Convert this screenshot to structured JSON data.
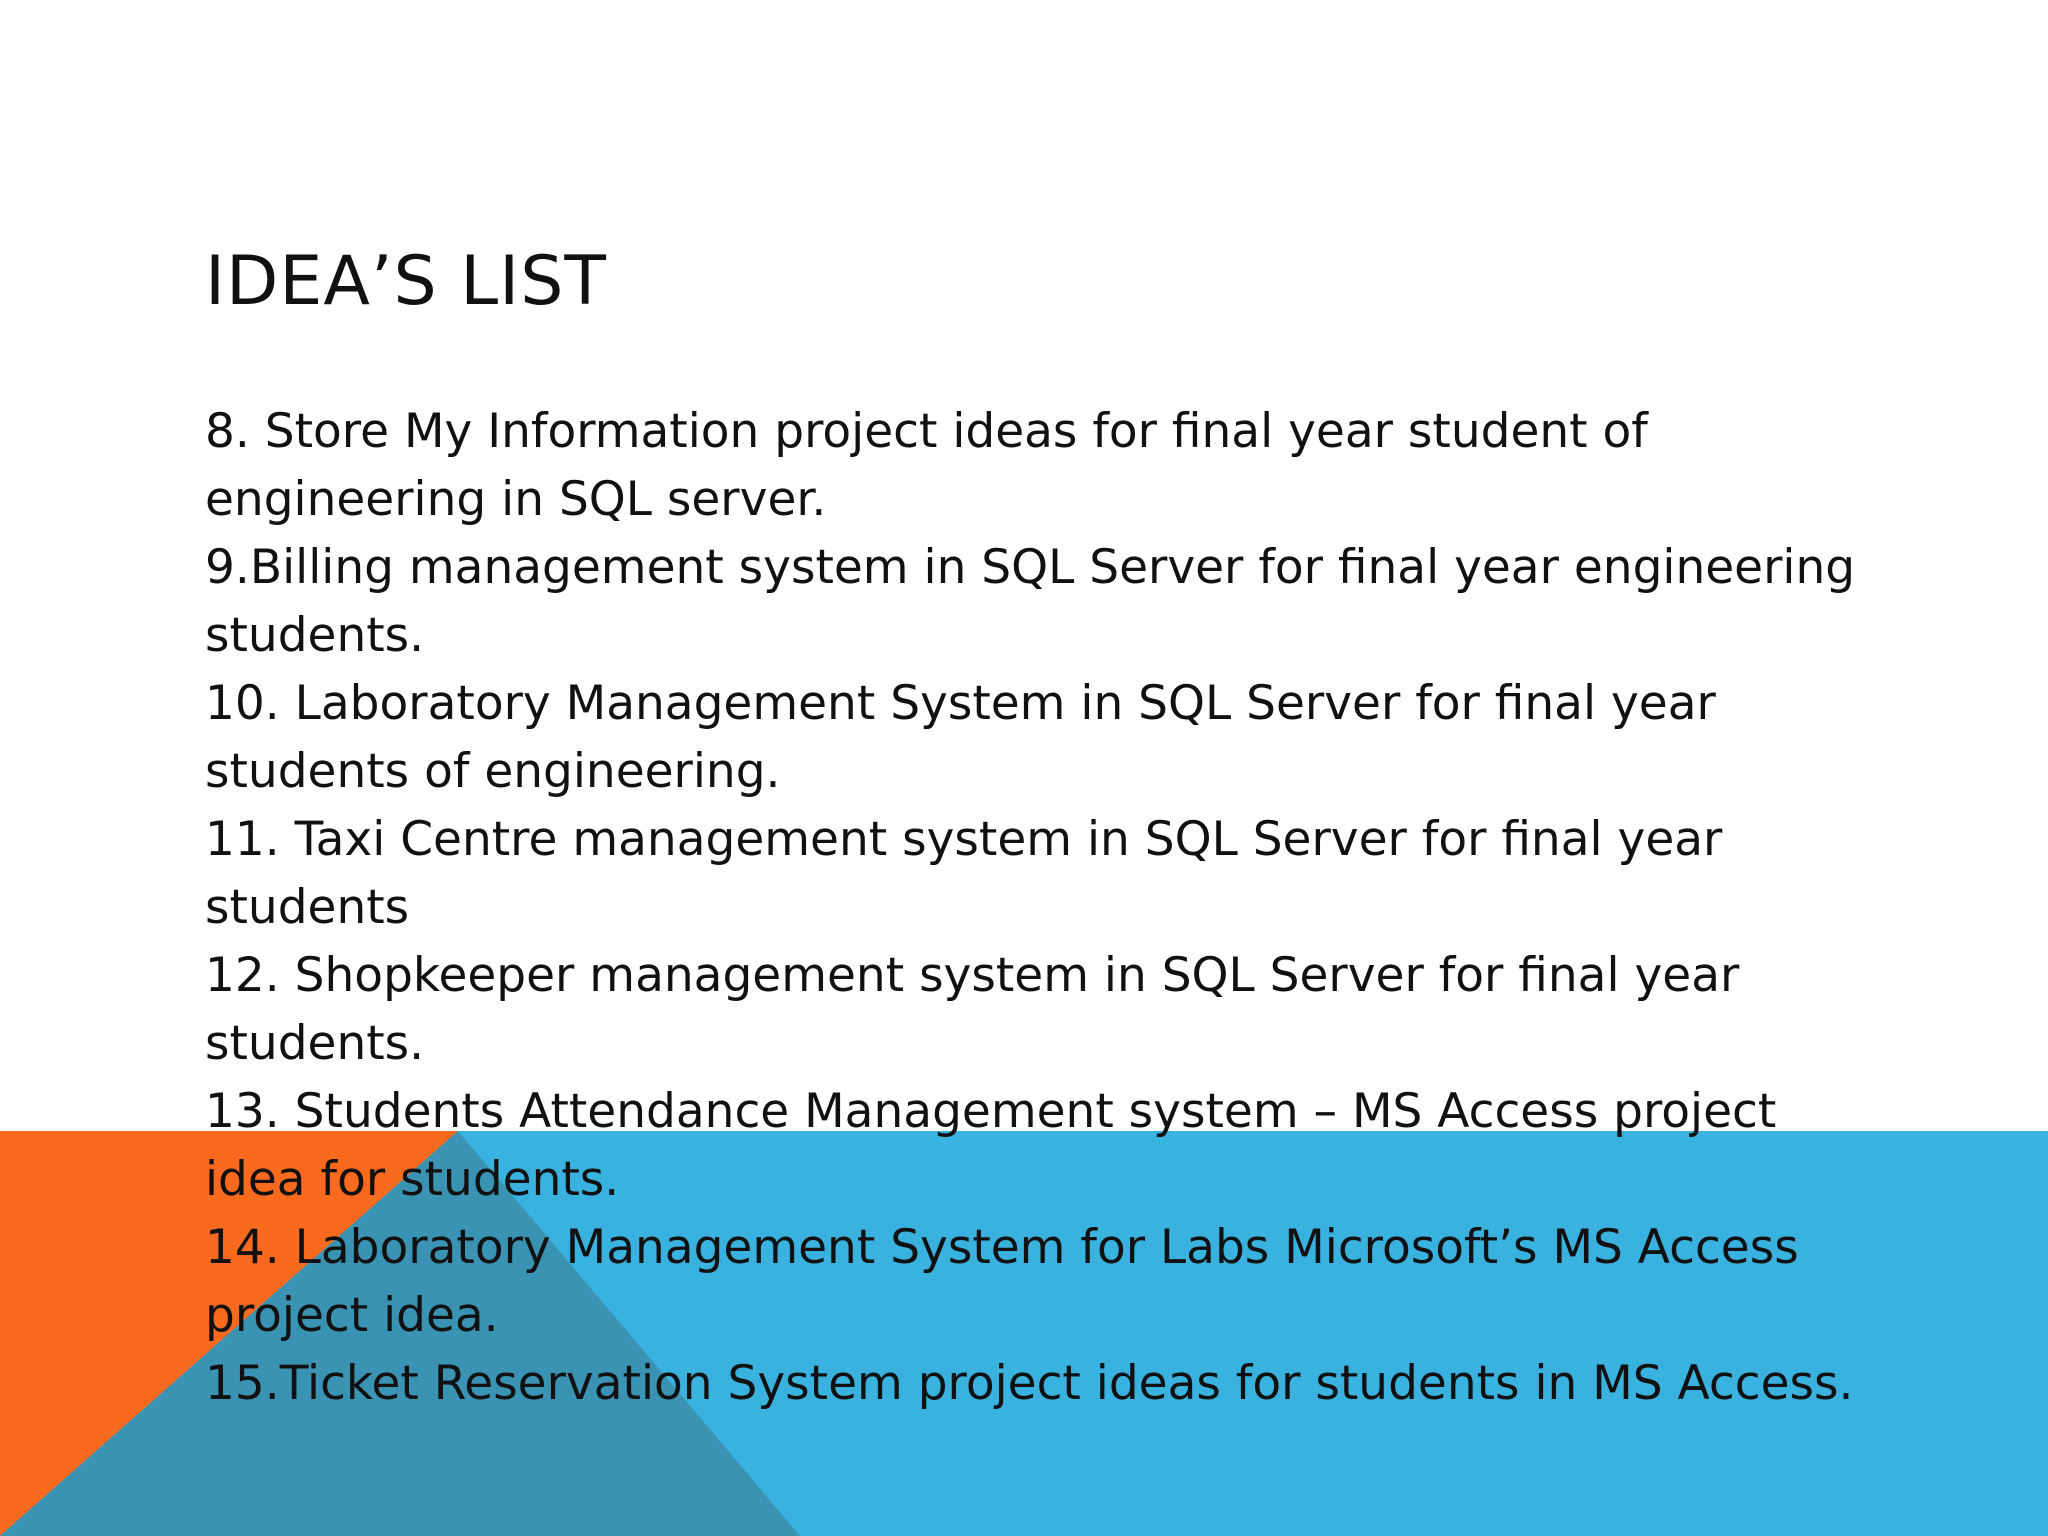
{
  "slide": {
    "title": "IDEA’S LIST",
    "items": [
      "8. Store My Information project ideas for final year student of engineering in SQL server.",
      "9.Billing management system in SQL Server for final year engineering students.",
      "10. Laboratory Management System in SQL Server for final year students of engineering.",
      "11. Taxi Centre management system in SQL Server for final year students",
      "12. Shopkeeper management system in SQL Server for final year students.",
      "13. Students Attendance Management system – MS Access project idea for students.",
      "14. Laboratory Management System for Labs Microsoft’s MS Access project idea.",
      "15.Ticket Reservation System project ideas for students in MS Access."
    ]
  },
  "colors": {
    "background": "#ffffff",
    "blue_band": "#3ab2e0",
    "orange_band": "#f96a1f",
    "dark_overlay": "#3a93b3",
    "text": "#111111"
  }
}
